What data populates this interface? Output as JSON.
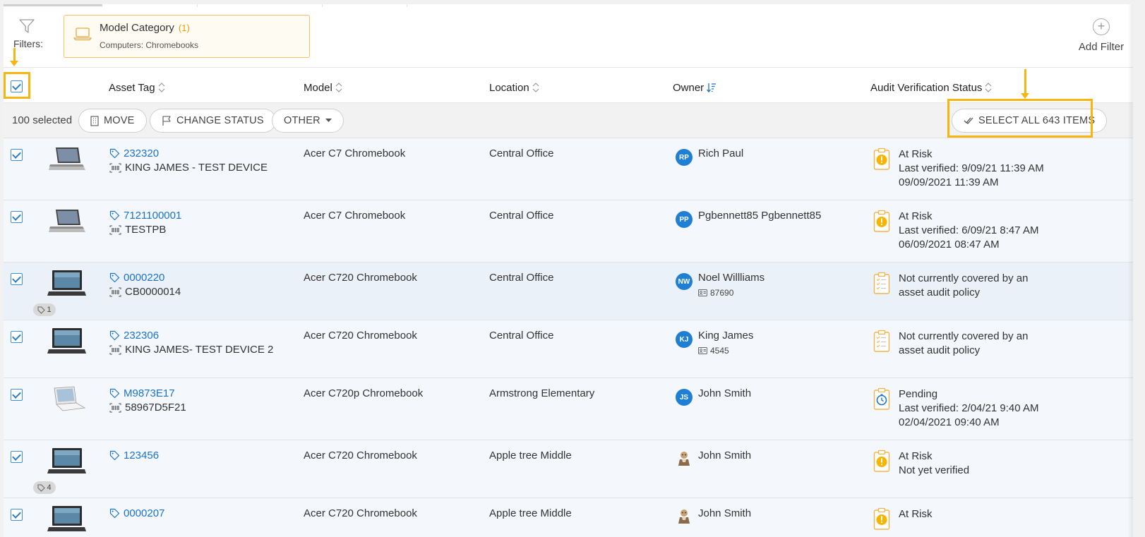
{
  "filters": {
    "label": "Filters:",
    "chip": {
      "title": "Model Category",
      "count": "(1)",
      "subtitle": "Computers: Chromebooks"
    },
    "add_filter": "Add Filter"
  },
  "columns": {
    "asset_tag": "Asset Tag",
    "model": "Model",
    "location": "Location",
    "owner": "Owner",
    "audit_status": "Audit Verification Status"
  },
  "bulk": {
    "selected": "100 selected",
    "move": "MOVE",
    "change_status": "CHANGE STATUS",
    "other": "OTHER",
    "select_all": "SELECT ALL 643 ITEMS"
  },
  "colors": {
    "accent": "#1a73c9",
    "highlight": "#f7b512",
    "avatar": "#1f7fd4",
    "risk": "#f4b400"
  },
  "rows": [
    {
      "asset_tag": "232320",
      "serial": "KING JAMES - TEST DEVICE",
      "model": "Acer C7 Chromebook",
      "location": "Central Office",
      "owner_initials": "RP",
      "owner": "Rich Paul",
      "owner_id": "",
      "tag_count": "",
      "status_icon": "at-risk-icon",
      "status_lines": [
        "At Risk",
        "Last verified: 9/09/21 11:39 AM",
        "09/09/2021 11:39 AM"
      ]
    },
    {
      "asset_tag": "7121100001",
      "serial": "TESTPB",
      "model": "Acer C7 Chromebook",
      "location": "Central Office",
      "owner_initials": "PP",
      "owner": "Pgbennett85 Pgbennett85",
      "owner_id": "",
      "tag_count": "",
      "status_icon": "at-risk-icon",
      "status_lines": [
        "At Risk",
        "Last verified: 6/09/21 8:47 AM",
        "06/09/2021 08:47 AM"
      ]
    },
    {
      "asset_tag": "0000220",
      "serial": "CB0000014",
      "model": "Acer C720 Chromebook",
      "location": "Central Office",
      "owner_initials": "NW",
      "owner": "Noel Willliams",
      "owner_id": "87690",
      "tag_count": "1",
      "status_icon": "checklist-icon",
      "status_lines": [
        "Not currently covered by an",
        "asset audit policy"
      ]
    },
    {
      "asset_tag": "232306",
      "serial": "KING JAMES- TEST DEVICE 2",
      "model": "Acer C720 Chromebook",
      "location": "Central Office",
      "owner_initials": "KJ",
      "owner": "King James",
      "owner_id": "4545",
      "tag_count": "",
      "status_icon": "checklist-icon",
      "status_lines": [
        "Not currently covered by an",
        "asset audit policy"
      ]
    },
    {
      "asset_tag": "M9873E17",
      "serial": "58967D5F21",
      "model": "Acer C720p Chromebook",
      "location": "Armstrong Elementary",
      "owner_initials": "JS",
      "owner": "John Smith",
      "owner_id": "",
      "tag_count": "",
      "status_icon": "pending-icon",
      "status_lines": [
        "Pending",
        "Last verified: 2/04/21 9:40 AM",
        "02/04/2021 09:40 AM"
      ]
    },
    {
      "asset_tag": "123456",
      "serial": "",
      "model": "Acer C720 Chromebook",
      "location": "Apple tree Middle",
      "owner_initials": "",
      "owner": "John Smith",
      "owner_id": "",
      "tag_count": "4",
      "status_icon": "at-risk-icon",
      "status_lines": [
        "At Risk",
        "Not yet verified"
      ]
    },
    {
      "asset_tag": "0000207",
      "serial": "",
      "model": "Acer C720 Chromebook",
      "location": "Apple tree Middle",
      "owner_initials": "",
      "owner": "John Smith",
      "owner_id": "",
      "tag_count": "",
      "status_icon": "at-risk-icon",
      "status_lines": [
        "At Risk"
      ]
    }
  ]
}
